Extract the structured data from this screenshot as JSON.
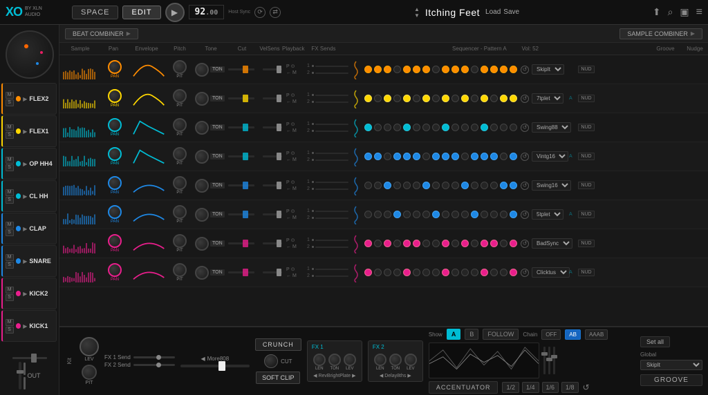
{
  "header": {
    "logo": "XO",
    "logo_sub1": "BY XLN",
    "logo_sub2": "AUDIO",
    "nav_space": "SPACE",
    "nav_edit": "EDIT",
    "bpm": "92",
    "bpm_decimal": "00",
    "host_sync": "Host\nSync",
    "preset_name": "Itching Feet",
    "btn_load": "Load",
    "btn_save": "Save",
    "icon_share": "⬆",
    "icon_search": "🔍",
    "icon_folder": "📁",
    "icon_menu": "≡"
  },
  "beat_combiner": "BEAT COMBINER",
  "sample_combiner": "SAMPLE COMBINER",
  "col_headers": {
    "sample": "Sample",
    "pan": "Pan",
    "envelope": "Envelope",
    "pitch": "Pitch",
    "tone": "Tone",
    "cut": "Cut",
    "vel_sens": "VelSens",
    "playback": "Playback",
    "fx_sends": "FX Sends",
    "sequencer": "Sequencer - Pattern A",
    "vel": "Vol: 52",
    "groove": "Groove",
    "nudge": "Nudge"
  },
  "tracks": [
    {
      "name": "FLEX2",
      "color": "#ff8c00",
      "groove": "SkipIt",
      "nudge": "NUD",
      "seq_pattern": [
        1,
        1,
        1,
        0,
        1,
        1,
        1,
        0,
        1,
        1,
        1,
        0,
        1,
        1,
        1,
        1
      ],
      "seq_color": "orange"
    },
    {
      "name": "FLEX1",
      "color": "#ffd700",
      "groove": "7tplet",
      "nudge": "NUD",
      "seq_pattern": [
        1,
        0,
        1,
        0,
        1,
        0,
        1,
        0,
        1,
        0,
        1,
        0,
        1,
        0,
        1,
        1
      ],
      "seq_color": "yellow"
    },
    {
      "name": "OP HH4",
      "color": "#00bcd4",
      "groove": "Swing88",
      "nudge": "NUD",
      "seq_pattern": [
        1,
        0,
        0,
        0,
        1,
        0,
        0,
        0,
        1,
        0,
        0,
        0,
        1,
        0,
        0,
        0
      ],
      "seq_color": "cyan"
    },
    {
      "name": "CL HH",
      "color": "#00bcd4",
      "groove": "Vintg16",
      "nudge": "NUD",
      "seq_pattern": [
        1,
        1,
        0,
        1,
        1,
        1,
        0,
        1,
        1,
        1,
        0,
        1,
        1,
        1,
        0,
        1
      ],
      "seq_color": "blue"
    },
    {
      "name": "CLAP",
      "color": "#1e88e5",
      "groove": "Swing16",
      "nudge": "NUD",
      "seq_pattern": [
        0,
        0,
        1,
        0,
        0,
        0,
        1,
        0,
        0,
        0,
        1,
        0,
        0,
        0,
        1,
        1
      ],
      "seq_color": "blue"
    },
    {
      "name": "SNARE",
      "color": "#1e88e5",
      "groove": "5tplet",
      "nudge": "NUD",
      "seq_pattern": [
        0,
        0,
        0,
        1,
        0,
        0,
        0,
        1,
        0,
        0,
        0,
        1,
        0,
        0,
        0,
        1
      ],
      "seq_color": "blue"
    },
    {
      "name": "KICK2",
      "color": "#e91e8c",
      "groove": "BadSync",
      "nudge": "NUD",
      "seq_pattern": [
        1,
        0,
        1,
        0,
        1,
        1,
        0,
        0,
        1,
        0,
        1,
        0,
        1,
        1,
        0,
        1
      ],
      "seq_color": "pink"
    },
    {
      "name": "KICK1",
      "color": "#e91e8c",
      "groove": "Clicktus",
      "nudge": "NUD",
      "seq_pattern": [
        1,
        0,
        0,
        0,
        1,
        0,
        0,
        0,
        1,
        0,
        0,
        0,
        1,
        0,
        0,
        1
      ],
      "seq_color": "pink"
    }
  ],
  "bottom": {
    "kit_section": {
      "lev_label": "LEV",
      "pit_label": "PIT",
      "fx1_send_label": "FX 1 Send",
      "fx2_send_label": "FX 2 Send",
      "more808_label": "More808"
    },
    "fx1": {
      "label": "FX 1",
      "len_label": "LEN",
      "ton_label": "TON",
      "lev_label": "LEV",
      "reverb_name": "RevBrightPlate"
    },
    "fx2": {
      "label": "FX 2",
      "len_label": "LEN",
      "ton_label": "TON",
      "lev_label": "LEV",
      "delay_name": "Delay8ths"
    },
    "master_knobs": {
      "crunch_label": "CRUNCH",
      "cut_label": "CUT",
      "soft_clip_label": "SOFT CLIP"
    },
    "sequencer_bottom": {
      "show_label": "Show",
      "btn_a": "A",
      "btn_b": "B",
      "btn_follow": "FOLLOW",
      "chain_label": "Chain",
      "btn_off": "OFF",
      "btn_ab": "AB",
      "btn_aaab": "AAAB"
    },
    "accentuator": {
      "label": "ACCENTUATOR",
      "frac_1_2": "1/2",
      "frac_1_4": "1/4",
      "frac_1_6": "1/6",
      "frac_1_8": "1/8"
    },
    "global": {
      "label": "Global",
      "skip_label": "SkipIt",
      "groove_label": "GROOVE"
    },
    "set_all": "Set all",
    "out_label": "OUT"
  }
}
